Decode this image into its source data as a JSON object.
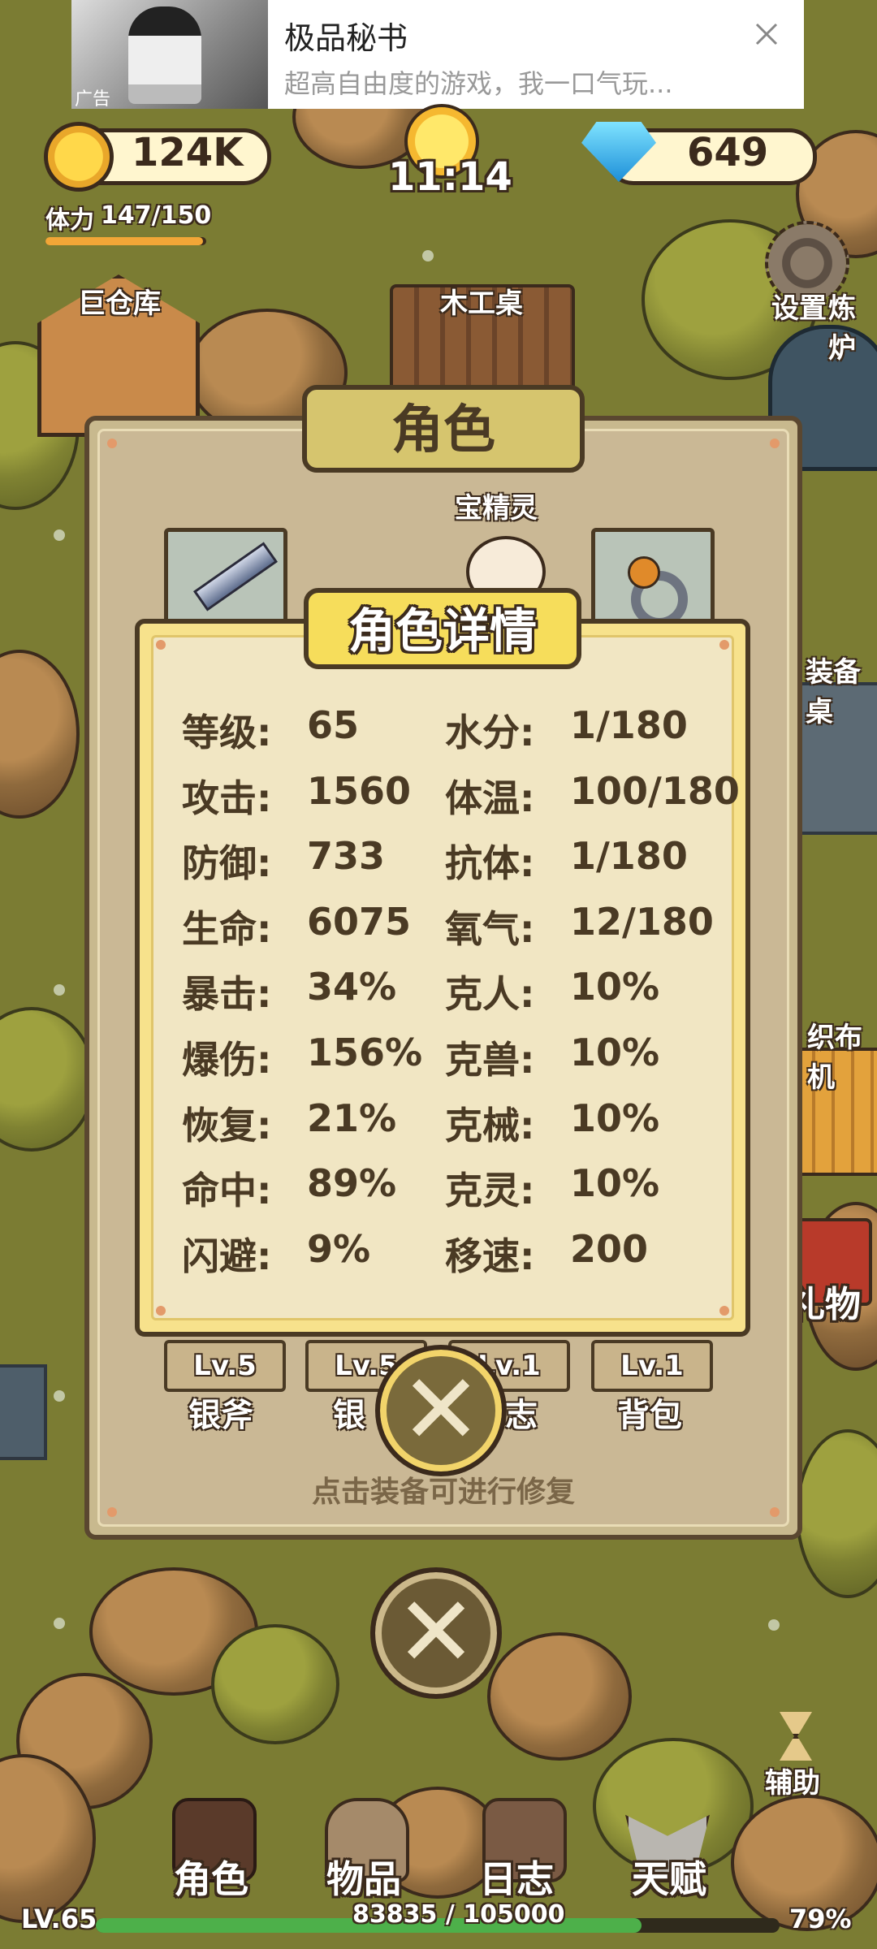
{
  "ad": {
    "title": "极品秘书",
    "subtitle": "超高自由度的游戏，我一口气玩...",
    "tag": "广告",
    "close_icon": "close-icon"
  },
  "hud": {
    "coins": "124K",
    "time": "11:14",
    "gems": "649",
    "stamina_label": "体力",
    "stamina_value": "147/150",
    "stamina_fraction": 0.98
  },
  "map_labels": {
    "warehouse": "巨仓库",
    "workbench": "木工桌",
    "settings": "设置",
    "smelter": "炼炉",
    "equip_table": "装备桌",
    "loom": "织布机",
    "gift": "礼物",
    "assist": "辅助"
  },
  "role_panel": {
    "title": "角色",
    "pet_name": "宝精灵",
    "slots": [
      {
        "level": "Lv.5",
        "name": "银斧"
      },
      {
        "level": "Lv.5",
        "name": "银"
      },
      {
        "level": "Lv.1",
        "name": "志"
      },
      {
        "level": "Lv.1",
        "name": "背包"
      }
    ],
    "hint": "点击装备可进行修复"
  },
  "detail_panel": {
    "title": "角色详情",
    "stats_left": [
      {
        "label": "等级:",
        "value": "65"
      },
      {
        "label": "攻击:",
        "value": "1560"
      },
      {
        "label": "防御:",
        "value": "733"
      },
      {
        "label": "生命:",
        "value": "6075"
      },
      {
        "label": "暴击:",
        "value": "34%"
      },
      {
        "label": "爆伤:",
        "value": "156%"
      },
      {
        "label": "恢复:",
        "value": "21%"
      },
      {
        "label": "命中:",
        "value": "89%"
      },
      {
        "label": "闪避:",
        "value": "9%"
      }
    ],
    "stats_right": [
      {
        "label": "水分:",
        "value": "1/180"
      },
      {
        "label": "体温:",
        "value": "100/180"
      },
      {
        "label": "抗体:",
        "value": "1/180"
      },
      {
        "label": "氧气:",
        "value": "12/180"
      },
      {
        "label": "克人:",
        "value": "10%"
      },
      {
        "label": "克兽:",
        "value": "10%"
      },
      {
        "label": "克械:",
        "value": "10%"
      },
      {
        "label": "克灵:",
        "value": "10%"
      },
      {
        "label": "移速:",
        "value": "200"
      }
    ]
  },
  "bottom_nav": {
    "items": [
      {
        "label": "角色",
        "icon": "character-icon"
      },
      {
        "label": "物品",
        "icon": "backpack-icon"
      },
      {
        "label": "日志",
        "icon": "journal-icon"
      },
      {
        "label": "天赋",
        "icon": "talent-wings-icon"
      }
    ],
    "level": "LV.65",
    "exp": "83835 / 105000",
    "percent": "79%",
    "exp_fraction": 0.798
  },
  "colors": {
    "grass": "#7b7c33",
    "panel_border": "#4a3a24",
    "gold": "#f2c94c",
    "exp_green": "#4db04a"
  }
}
